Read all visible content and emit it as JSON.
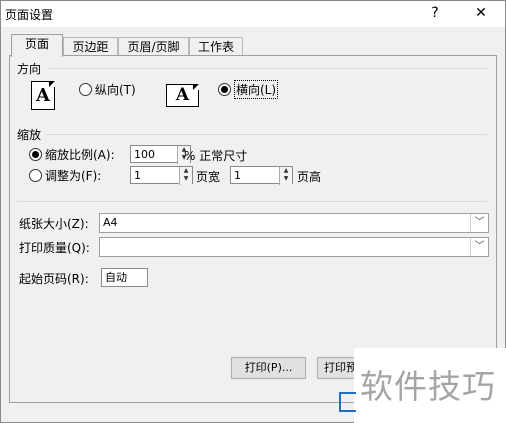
{
  "window": {
    "title": "页面设置",
    "help_glyph": "?",
    "close_glyph": "✕"
  },
  "tabs": [
    {
      "label": "页面",
      "active": true
    },
    {
      "label": "页边距",
      "active": false
    },
    {
      "label": "页眉/页脚",
      "active": false
    },
    {
      "label": "工作表",
      "active": false
    }
  ],
  "orientation": {
    "heading": "方向",
    "portrait_label": "纵向(T)",
    "landscape_label": "横向(L)",
    "selected": "landscape",
    "icon_letter": "A"
  },
  "scaling": {
    "heading": "缩放",
    "adjust_label": "缩放比例(A):",
    "adjust_value": "100",
    "percent_suffix": "% 正常尺寸",
    "fit_label": "调整为(F):",
    "fit_wide_value": "1",
    "fit_wide_suffix": "页宽",
    "fit_tall_value": "1",
    "fit_tall_suffix": "页高",
    "selected": "adjust"
  },
  "paper": {
    "size_label": "纸张大小(Z):",
    "size_value": "A4",
    "quality_label": "打印质量(Q):",
    "quality_value": "",
    "first_page_label": "起始页码(R):",
    "first_page_value": "自动"
  },
  "buttons": {
    "print": "打印(P)...",
    "print_preview": "打印预"
  },
  "watermark": "软件技巧",
  "icons": {
    "spin_up": "▲",
    "spin_down": "▼",
    "dropdown": "﹀"
  }
}
